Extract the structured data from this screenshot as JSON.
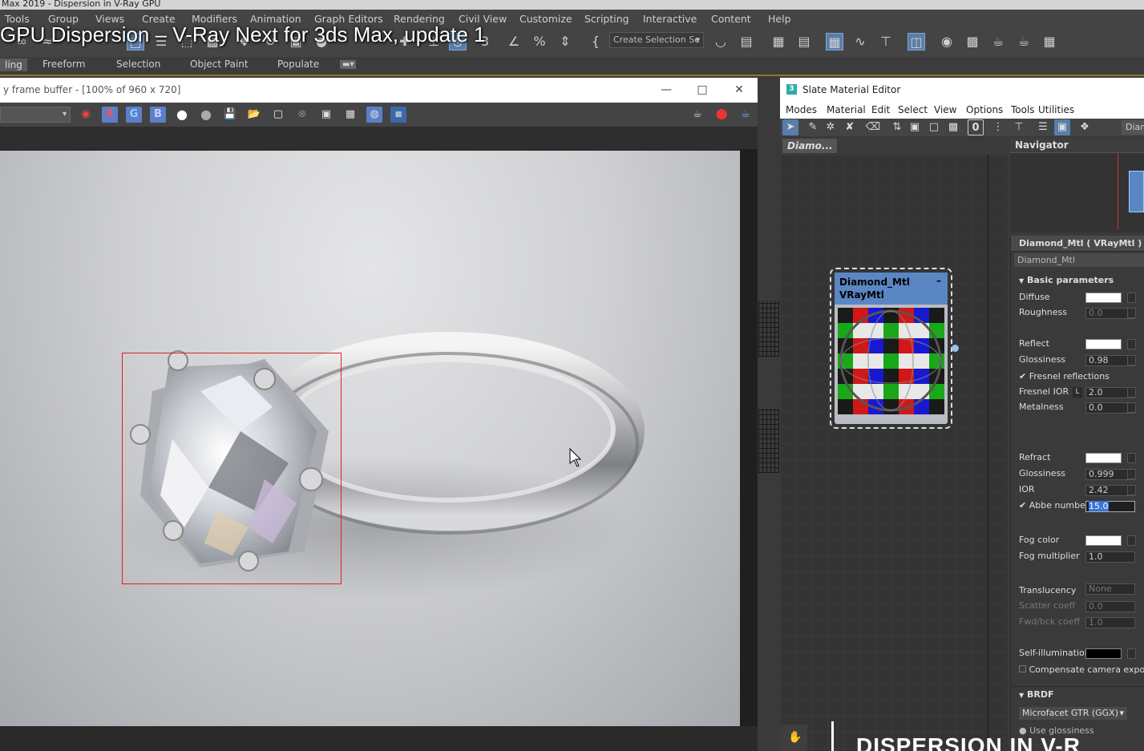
{
  "window_title": "Max 2019 - Dispersion in V-Ray GPU",
  "video_title": "GPU Dispersion – V-Ray Next for 3ds Max, update 1",
  "menu": [
    "Tools",
    "Group",
    "Views",
    "Create",
    "Modifiers",
    "Animation",
    "Graph Editors",
    "Rendering",
    "Civil View",
    "Customize",
    "Scripting",
    "Interactive",
    "Content",
    "Help"
  ],
  "toolbar": {
    "selection_set": "Create Selection Se"
  },
  "ribbon": {
    "tabs": [
      "ling",
      "Freeform",
      "Selection",
      "Object Paint",
      "Populate"
    ]
  },
  "vfb": {
    "title": "y frame buffer - [100% of 960 x 720]",
    "channels": [
      "R",
      "G",
      "B"
    ],
    "minimize": "—",
    "maximize": "□",
    "close": "✕"
  },
  "sme": {
    "title": "Slate Material Editor",
    "menu": [
      "Modes",
      "Material",
      "Edit",
      "Select",
      "View",
      "Options",
      "Tools",
      "Utilities"
    ],
    "view_tab": "Diamo...",
    "node": {
      "name": "Diamond_Mtl",
      "type": "VRayMtl",
      "collapse": "–"
    },
    "navigator": "Navigator",
    "header_right": "Diam",
    "material_header": "Diamond_Mtl  ( VRayMtl )",
    "material_name": "Diamond_Mtl"
  },
  "params": {
    "basic_title": "Basic parameters",
    "diffuse": "Diffuse",
    "roughness": "Roughness",
    "roughness_val": "0.0",
    "reflect": "Reflect",
    "glossiness": "Glossiness",
    "refl_gloss_val": "0.98",
    "fresnel_refl": "Fresnel reflections",
    "fresnel_ior": "Fresnel IOR",
    "lock": "L",
    "fresnel_ior_val": "2.0",
    "metalness": "Metalness",
    "metalness_val": "0.0",
    "refract": "Refract",
    "refr_gloss_val": "0.999",
    "ior": "IOR",
    "ior_val": "2.42",
    "abbe": "Abbe number",
    "abbe_val": "15.0",
    "fog_color": "Fog color",
    "fog_mult": "Fog multiplier",
    "fog_mult_val": "1.0",
    "translucency": "Translucency",
    "translucency_val": "None",
    "scatter": "Scatter coeff",
    "scatter_val": "0.0",
    "fwd": "Fwd/bck coeff",
    "fwd_val": "1.0",
    "self_illum": "Self-illumination",
    "compensate": "Compensate camera exposure",
    "brdf_title": "BRDF",
    "brdf_type": "Microfacet GTR (GGX)",
    "use_gloss": "Use glossiness"
  },
  "bottom_overlay": "DISPERSION IN V-R"
}
